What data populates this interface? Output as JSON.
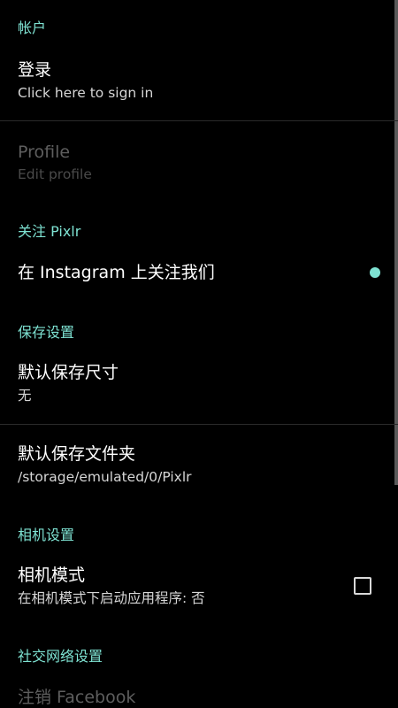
{
  "accent_color": "#7ee2d2",
  "sections": {
    "account": "帐户",
    "follow": "关注 Pixlr",
    "save": "保存设置",
    "camera": "相机设置",
    "social": "社交网络设置"
  },
  "prefs": {
    "login": {
      "title": "登录",
      "summary": "Click here to sign in"
    },
    "profile": {
      "title": "Profile",
      "summary": "Edit profile",
      "enabled": false
    },
    "instagram": {
      "title": "在 Instagram 上关注我们",
      "indicator": "dot-icon"
    },
    "save_size": {
      "title": "默认保存尺寸",
      "summary": "无"
    },
    "save_folder": {
      "title": "默认保存文件夹",
      "summary": "/storage/emulated/0/Pixlr"
    },
    "camera_mode": {
      "title": "相机模式",
      "summary": "在相机模式下启动应用程序: 否",
      "checked": false
    },
    "facebook_logout": {
      "title": "注销 Facebook",
      "enabled": false
    }
  }
}
